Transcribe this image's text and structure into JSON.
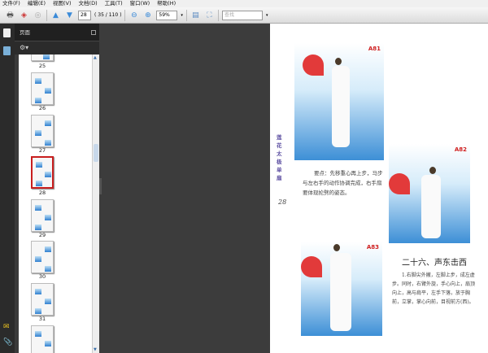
{
  "menu": [
    "文件(F)",
    "编辑(E)",
    "视图(V)",
    "文档(D)",
    "工具(T)",
    "窗口(W)",
    "帮助(H)"
  ],
  "toolbar": {
    "page_input": "28",
    "page_count": "( 35 / 110 )",
    "zoom": "59%",
    "find_placeholder": "查找"
  },
  "panel": {
    "title": "页面"
  },
  "thumbnails": [
    {
      "label": "25"
    },
    {
      "label": "26"
    },
    {
      "label": "27"
    },
    {
      "label": "28",
      "selected": true
    },
    {
      "label": "29"
    },
    {
      "label": "30"
    },
    {
      "label": "31"
    }
  ],
  "page": {
    "fig1": "A81",
    "fig2": "A82",
    "fig3": "A83",
    "side_title": "莲花太极单扇",
    "page_number": "28",
    "note": "要点：先移重心再上步，马步与左右手的动作协调完成，右手扇要体现抡劈的姿态。",
    "heading": "二十六、声东击西",
    "body": "1.右脚尖外撇，左脚上步，成左虚步。同时，右臂外旋，手心向上，扇顶向上，高与肩平，左手下落，放于胸前，立掌，掌心向前，目视前方(西)。"
  }
}
